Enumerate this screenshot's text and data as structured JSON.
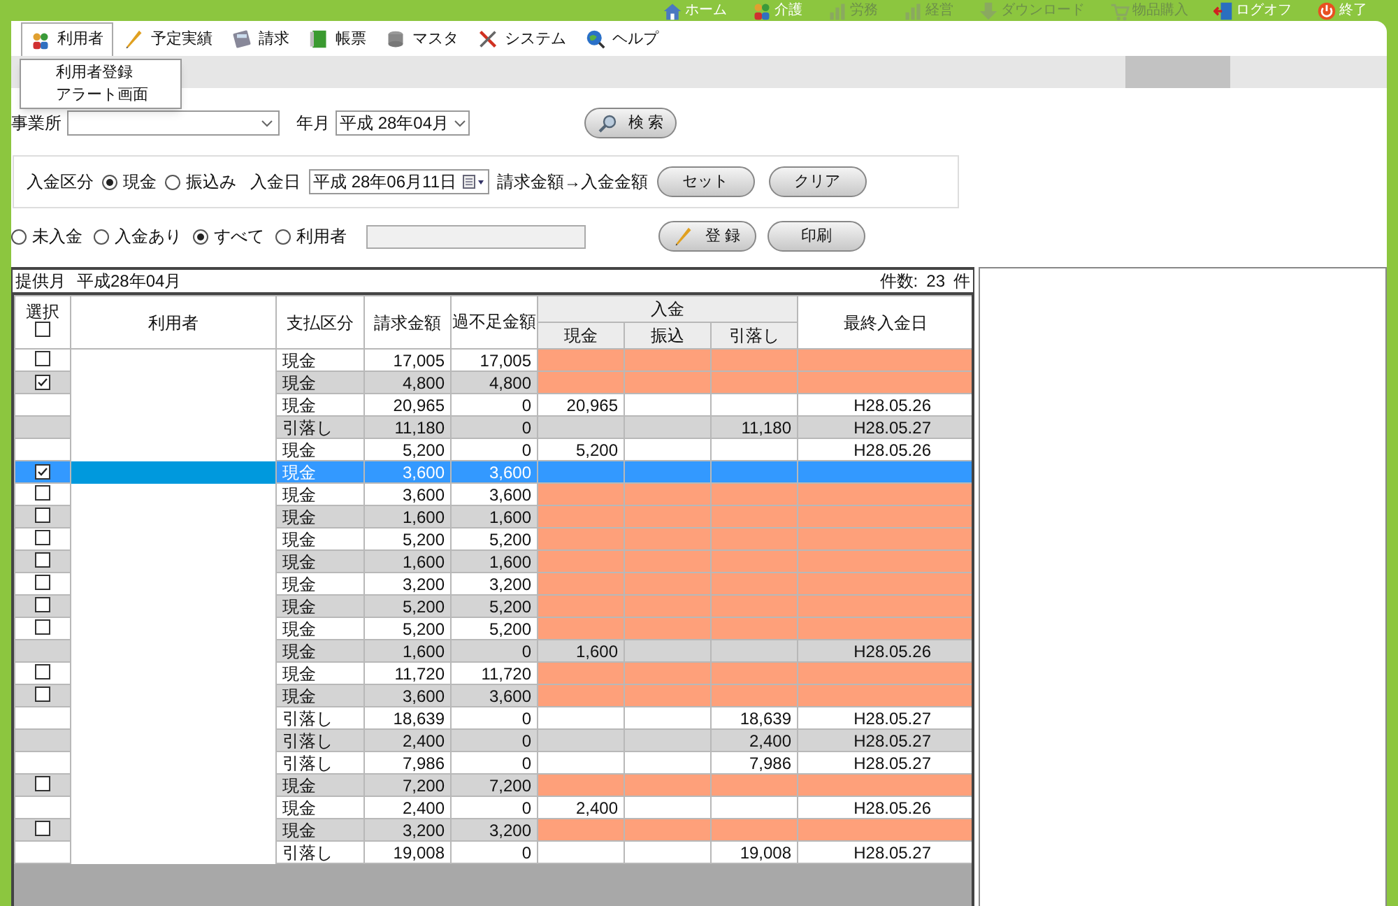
{
  "top_links": [
    {
      "label": "ホーム",
      "kind": "home",
      "disabled": false
    },
    {
      "label": "介護",
      "kind": "care",
      "disabled": false
    },
    {
      "label": "労務",
      "kind": "labor",
      "disabled": true
    },
    {
      "label": "経営",
      "kind": "business",
      "disabled": true
    },
    {
      "label": "ダウンロード",
      "kind": "download",
      "disabled": true
    },
    {
      "label": "物品購入",
      "kind": "shop",
      "disabled": true
    },
    {
      "label": "ログオフ",
      "kind": "logoff",
      "disabled": false
    },
    {
      "label": "終了",
      "kind": "exit",
      "disabled": false
    }
  ],
  "menu": [
    {
      "label": "利用者",
      "kind": "users",
      "selected": true
    },
    {
      "label": "予定実績",
      "kind": "plan",
      "selected": false
    },
    {
      "label": "請求",
      "kind": "billing",
      "selected": false
    },
    {
      "label": "帳票",
      "kind": "forms",
      "selected": false
    },
    {
      "label": "マスタ",
      "kind": "master",
      "selected": false
    },
    {
      "label": "システム",
      "kind": "system",
      "selected": false
    },
    {
      "label": "ヘルプ",
      "kind": "help",
      "selected": false
    }
  ],
  "dropdown": [
    "利用者登録",
    "アラート画面"
  ],
  "filter": {
    "office_label": "事業所",
    "month_label": "年月",
    "month_value": "平成 28年04月",
    "search_button": "検 索"
  },
  "payment": {
    "label": "入金区分",
    "options": [
      {
        "label": "現金",
        "selected": true
      },
      {
        "label": "振込み",
        "selected": false
      }
    ],
    "date_label": "入金日",
    "date_value": "平成 28年06月11日",
    "copy_label": "請求金額→入金金額",
    "buttons": [
      "セット",
      "クリア"
    ]
  },
  "status_filter": {
    "options": [
      {
        "label": "未入金",
        "selected": false
      },
      {
        "label": "入金あり",
        "selected": false
      },
      {
        "label": "すべて",
        "selected": true
      },
      {
        "label": "利用者",
        "selected": false
      }
    ],
    "register_button": "登 録",
    "print_button": "印刷"
  },
  "summary": {
    "month_label": "提供月",
    "month_value": "平成28年04月",
    "count_label": "件数:",
    "count": "23",
    "count_unit": "件"
  },
  "table": {
    "header": {
      "select": "選択",
      "select_all": false,
      "user": "利用者",
      "pay_type": "支払区分",
      "billed": "請求金額",
      "shortage": "過不足金額",
      "payment": "入金",
      "cash": "現金",
      "transfer": "振込",
      "debit": "引落し",
      "last_date": "最終入金日"
    },
    "rows": [
      {
        "kind": "checkable",
        "checked": false,
        "pay_type": "現金",
        "billed": "17,005",
        "shortage": "17,005",
        "unpaid": true,
        "selected": false
      },
      {
        "kind": "checkable",
        "checked": true,
        "pay_type": "現金",
        "billed": "4,800",
        "shortage": "4,800",
        "unpaid": true,
        "selected": false
      },
      {
        "kind": "plain",
        "pay_type": "現金",
        "billed": "20,965",
        "shortage": "0",
        "cash": "20,965",
        "last_date": "H28.05.26",
        "unpaid": false,
        "selected": false
      },
      {
        "kind": "plain",
        "pay_type": "引落し",
        "billed": "11,180",
        "shortage": "0",
        "debit": "11,180",
        "last_date": "H28.05.27",
        "unpaid": false,
        "selected": false
      },
      {
        "kind": "plain",
        "pay_type": "現金",
        "billed": "5,200",
        "shortage": "0",
        "cash": "5,200",
        "last_date": "H28.05.26",
        "unpaid": false,
        "selected": false
      },
      {
        "kind": "checkable",
        "checked": true,
        "pay_type": "現金",
        "billed": "3,600",
        "shortage": "3,600",
        "unpaid": true,
        "selected": true
      },
      {
        "kind": "checkable",
        "checked": false,
        "pay_type": "現金",
        "billed": "3,600",
        "shortage": "3,600",
        "unpaid": true,
        "selected": false
      },
      {
        "kind": "checkable",
        "checked": false,
        "pay_type": "現金",
        "billed": "1,600",
        "shortage": "1,600",
        "unpaid": true,
        "selected": false
      },
      {
        "kind": "checkable",
        "checked": false,
        "pay_type": "現金",
        "billed": "5,200",
        "shortage": "5,200",
        "unpaid": true,
        "selected": false
      },
      {
        "kind": "checkable",
        "checked": false,
        "pay_type": "現金",
        "billed": "1,600",
        "shortage": "1,600",
        "unpaid": true,
        "selected": false
      },
      {
        "kind": "checkable",
        "checked": false,
        "pay_type": "現金",
        "billed": "3,200",
        "shortage": "3,200",
        "unpaid": true,
        "selected": false
      },
      {
        "kind": "checkable",
        "checked": false,
        "pay_type": "現金",
        "billed": "5,200",
        "shortage": "5,200",
        "unpaid": true,
        "selected": false
      },
      {
        "kind": "checkable",
        "checked": false,
        "pay_type": "現金",
        "billed": "5,200",
        "shortage": "5,200",
        "unpaid": true,
        "selected": false
      },
      {
        "kind": "plain",
        "pay_type": "現金",
        "billed": "1,600",
        "shortage": "0",
        "cash": "1,600",
        "last_date": "H28.05.26",
        "unpaid": false,
        "selected": false
      },
      {
        "kind": "checkable",
        "checked": false,
        "pay_type": "現金",
        "billed": "11,720",
        "shortage": "11,720",
        "unpaid": true,
        "selected": false
      },
      {
        "kind": "checkable",
        "checked": false,
        "pay_type": "現金",
        "billed": "3,600",
        "shortage": "3,600",
        "unpaid": true,
        "selected": false
      },
      {
        "kind": "plain",
        "pay_type": "引落し",
        "billed": "18,639",
        "shortage": "0",
        "debit": "18,639",
        "last_date": "H28.05.27",
        "unpaid": false,
        "selected": false
      },
      {
        "kind": "plain",
        "pay_type": "引落し",
        "billed": "2,400",
        "shortage": "0",
        "debit": "2,400",
        "last_date": "H28.05.27",
        "unpaid": false,
        "selected": false
      },
      {
        "kind": "plain",
        "pay_type": "引落し",
        "billed": "7,986",
        "shortage": "0",
        "debit": "7,986",
        "last_date": "H28.05.27",
        "unpaid": false,
        "selected": false
      },
      {
        "kind": "checkable",
        "checked": false,
        "pay_type": "現金",
        "billed": "7,200",
        "shortage": "7,200",
        "unpaid": true,
        "selected": false
      },
      {
        "kind": "plain",
        "pay_type": "現金",
        "billed": "2,400",
        "shortage": "0",
        "cash": "2,400",
        "last_date": "H28.05.26",
        "unpaid": false,
        "selected": false
      },
      {
        "kind": "checkable",
        "checked": false,
        "pay_type": "現金",
        "billed": "3,200",
        "shortage": "3,200",
        "unpaid": true,
        "selected": false
      },
      {
        "kind": "plain",
        "pay_type": "引落し",
        "billed": "19,008",
        "shortage": "0",
        "debit": "19,008",
        "last_date": "H28.05.27",
        "unpaid": false,
        "selected": false
      }
    ]
  }
}
